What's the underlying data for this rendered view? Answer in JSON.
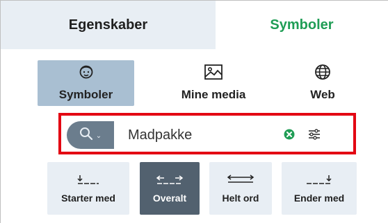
{
  "tabs": [
    {
      "label": "Egenskaber",
      "active": false
    },
    {
      "label": "Symboler",
      "active": true
    }
  ],
  "sources": [
    {
      "label": "Symboler",
      "icon": "face-icon",
      "selected": true
    },
    {
      "label": "Mine media",
      "icon": "image-icon",
      "selected": false
    },
    {
      "label": "Web",
      "icon": "globe-icon",
      "selected": false
    }
  ],
  "search": {
    "value": "Madpakke",
    "dropdown_icon": "search-icon",
    "clear_icon": "clear-icon",
    "filter_icon": "filter-icon",
    "highlight_color": "#e30613"
  },
  "match_modes": [
    {
      "label": "Starter med",
      "icon": "starts-with-icon",
      "selected": false
    },
    {
      "label": "Overalt",
      "icon": "anywhere-icon",
      "selected": true
    },
    {
      "label": "Helt ord",
      "icon": "whole-word-icon",
      "selected": false
    },
    {
      "label": "Ender med",
      "icon": "ends-with-icon",
      "selected": false
    }
  ],
  "colors": {
    "accent_green": "#1f9d55",
    "selected_source_bg": "#a9bfd2",
    "selected_mode_bg": "#52616f",
    "button_bg": "#e8eef4"
  }
}
